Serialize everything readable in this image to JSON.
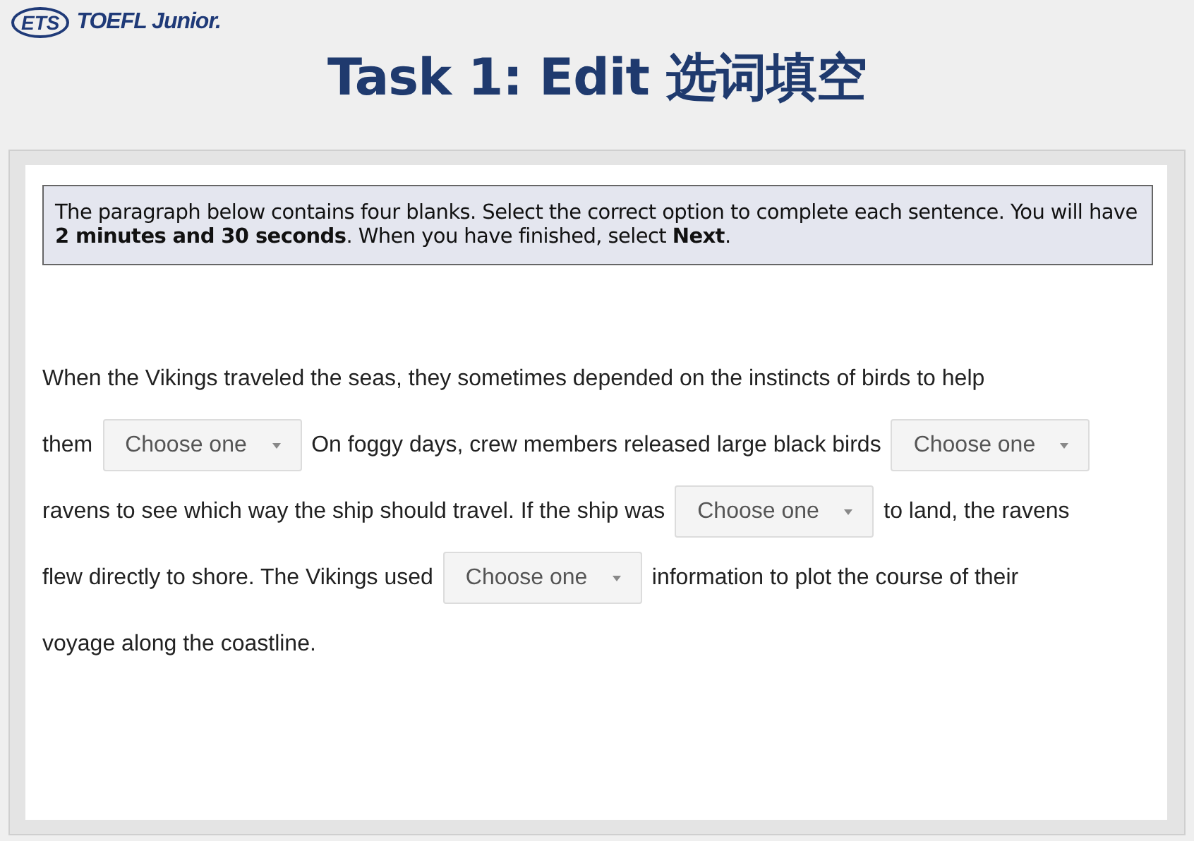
{
  "logo": {
    "mark": "ETS",
    "product": "TOEFL Junior."
  },
  "title": "Task 1: Edit 选词填空",
  "instructions": "The paragraph below contains four blanks. Select the correct option to complete each sentence. You will have **2 minutes and 30 seconds**. When you have finished, select **Next**.",
  "passage": [
    {
      "parts": [
        {
          "kind": "text",
          "text": "When the Vikings traveled the seas, they sometimes depended on the instincts of birds to help"
        }
      ]
    },
    {
      "parts": [
        {
          "kind": "text",
          "text": "them"
        },
        {
          "kind": "dropdown",
          "placeholder": "Choose one"
        },
        {
          "kind": "text",
          "text": "On foggy days, crew members released large black birds"
        },
        {
          "kind": "dropdown",
          "placeholder": "Choose one"
        }
      ]
    },
    {
      "parts": [
        {
          "kind": "text",
          "text": "ravens to see which way the ship should travel. If the ship was"
        },
        {
          "kind": "dropdown",
          "placeholder": "Choose one"
        },
        {
          "kind": "text",
          "text": "to land, the ravens"
        }
      ]
    },
    {
      "parts": [
        {
          "kind": "text",
          "text": "flew directly to shore. The Vikings used"
        },
        {
          "kind": "dropdown",
          "placeholder": "Choose one"
        },
        {
          "kind": "text",
          "text": "information to plot the course of their"
        }
      ]
    },
    {
      "parts": [
        {
          "kind": "text",
          "text": "voyage along the coastline."
        }
      ]
    }
  ]
}
